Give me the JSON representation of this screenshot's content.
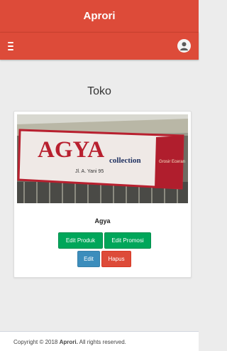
{
  "header": {
    "title": "Aprori"
  },
  "navbar": {
    "menu_icon": "hamburger-icon",
    "user_icon": "user-avatar-icon"
  },
  "page": {
    "title": "Toko"
  },
  "store_card": {
    "image_sign": {
      "main": "AGYA",
      "sub": "collection",
      "address": "Jl. A. Yani 95",
      "side": "Grosir Eceran"
    },
    "name": "Agya",
    "buttons": {
      "edit_produk": "Edit Produk",
      "edit_promosi": "Edit Promosi",
      "edit": "Edit",
      "hapus": "Hapus"
    }
  },
  "footer": {
    "copyright": "Copyright © 2018",
    "brand": "Aprori.",
    "rights": "All rights reserved."
  },
  "colors": {
    "header": "#dd4b39",
    "success": "#00a65a",
    "primary": "#3c8dbc",
    "danger": "#dd4b39",
    "background": "#ececec"
  }
}
